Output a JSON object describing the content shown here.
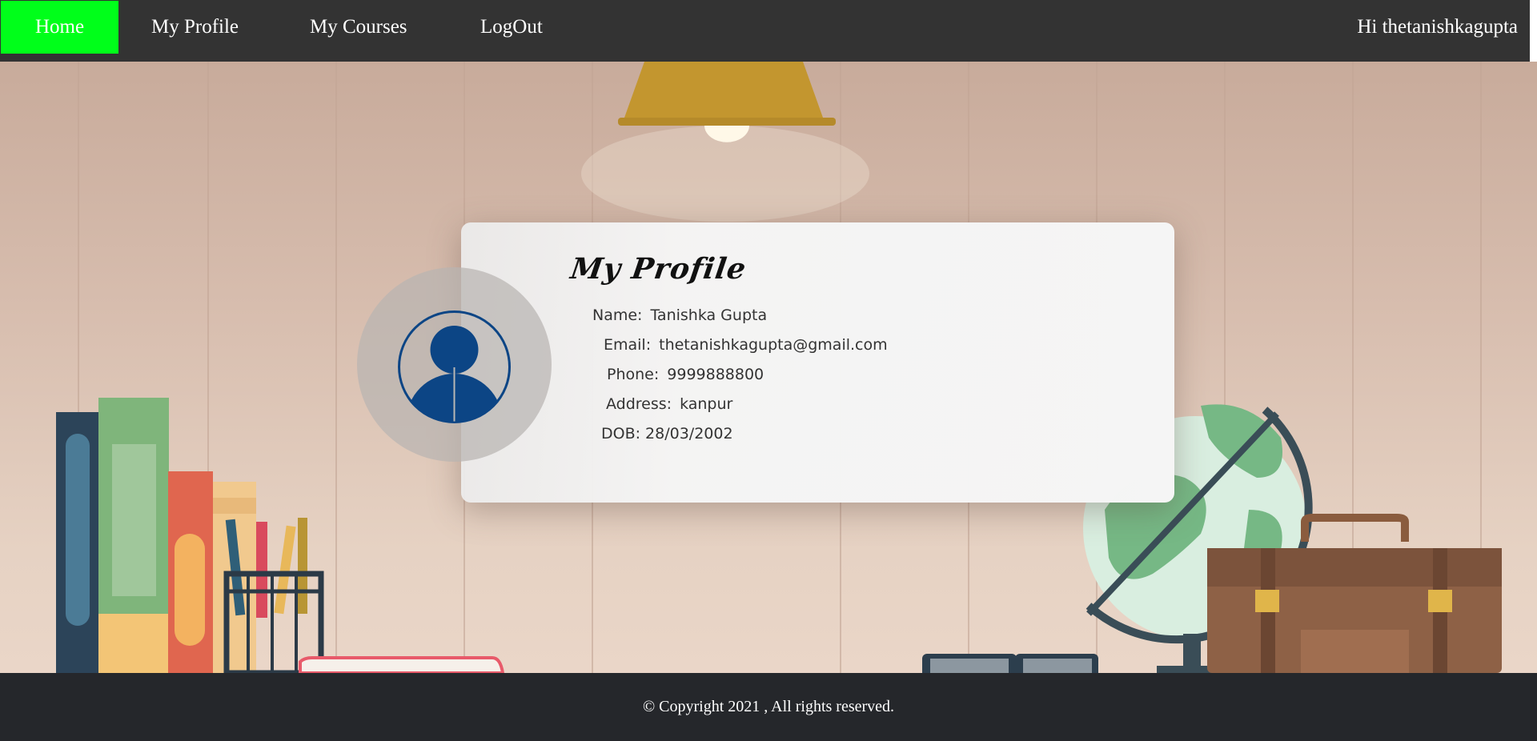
{
  "nav": {
    "home_label": "Home",
    "profile_label": "My Profile",
    "courses_label": "My Courses",
    "logout_label": "LogOut",
    "greeting": "Hi thetanishkagupta",
    "active_color": "#00ff1a",
    "bar_color": "#333333"
  },
  "profile": {
    "title": "My Profile",
    "name_label": "Name:",
    "name_value": "Tanishka Gupta",
    "email_label": "Email:",
    "email_value": "thetanishkagupta@gmail.com",
    "phone_label": "Phone:",
    "phone_value": "9999888800",
    "address_label": "Address:",
    "address_value": "kanpur",
    "dob_label": "DOB:",
    "dob_value": "28/03/2002",
    "avatar_icon": "user-avatar-icon",
    "avatar_color": "#0c4585"
  },
  "footer": {
    "copyright": "© Copyright 2021 , All rights reserved."
  }
}
